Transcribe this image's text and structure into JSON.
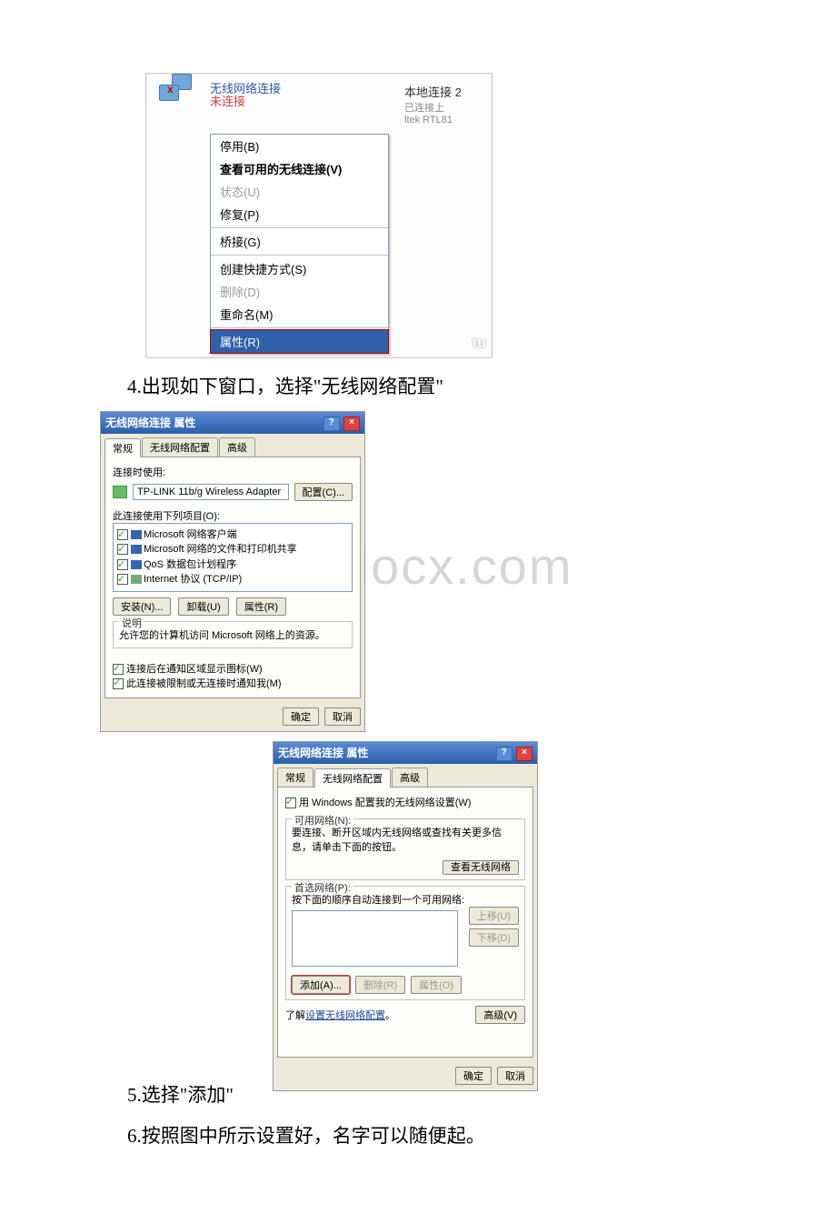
{
  "watermark": "www.bdocx.com",
  "text": {
    "p4": "4.出现如下窗口，选择\"无线网络配置\"",
    "p5": "5.选择\"添加\"",
    "p6": "6.按照图中所示设置好，名字可以随便起。"
  },
  "ss1": {
    "conn_name": "无线网络连接",
    "not_connected": "未连接",
    "right_title": "本地连接 2",
    "right_status": "已连接上",
    "right_adapter": "ltek RTL81",
    "menu": {
      "disable": "停用(B)",
      "view_available": "查看可用的无线连接(V)",
      "status": "状态(U)",
      "repair": "修复(P)",
      "bridge": "桥接(G)",
      "shortcut": "创建快捷方式(S)",
      "delete": "删除(D)",
      "rename": "重命名(M)",
      "properties": "属性(R)"
    },
    "wm": "tu"
  },
  "ss2": {
    "title": "无线网络连接 属性",
    "tabs": {
      "general": "常规",
      "wireless": "无线网络配置",
      "advanced": "高级"
    },
    "connect_using": "连接时使用:",
    "adapter": "TP-LINK 11b/g Wireless Adapter",
    "configure": "配置(C)...",
    "uses_items": "此连接使用下列项目(O):",
    "items": {
      "i1": "Microsoft 网络客户端",
      "i2": "Microsoft 网络的文件和打印机共享",
      "i3": "QoS 数据包计划程序",
      "i4": "Internet 协议 (TCP/IP)"
    },
    "install": "安装(N)...",
    "uninstall": "卸载(U)",
    "properties": "属性(R)",
    "desc_label": "说明",
    "desc_text": "允许您的计算机访问 Microsoft 网络上的资源。",
    "notify1": "连接后在通知区域显示图标(W)",
    "notify2": "此连接被限制或无连接时通知我(M)",
    "ok": "确定",
    "cancel": "取消"
  },
  "ss3": {
    "title": "无线网络连接 属性",
    "tabs": {
      "general": "常规",
      "wireless": "无线网络配置",
      "advanced": "高级"
    },
    "use_windows": "用 Windows 配置我的无线网络设置(W)",
    "available_label": "可用网络(N):",
    "available_desc": "要连接、断开区域内无线网络或查找有关更多信息，请单击下面的按钮。",
    "view_networks": "查看无线网络",
    "preferred_label": "首选网络(P):",
    "preferred_desc": "按下面的顺序自动连接到一个可用网络:",
    "move_up": "上移(U)",
    "move_down": "下移(D)",
    "add": "添加(A)...",
    "remove": "删除(R)",
    "properties": "属性(O)",
    "learn": "了解设置无线网络配置。",
    "advanced_btn": "高级(V)",
    "ok": "确定",
    "cancel": "取消"
  }
}
